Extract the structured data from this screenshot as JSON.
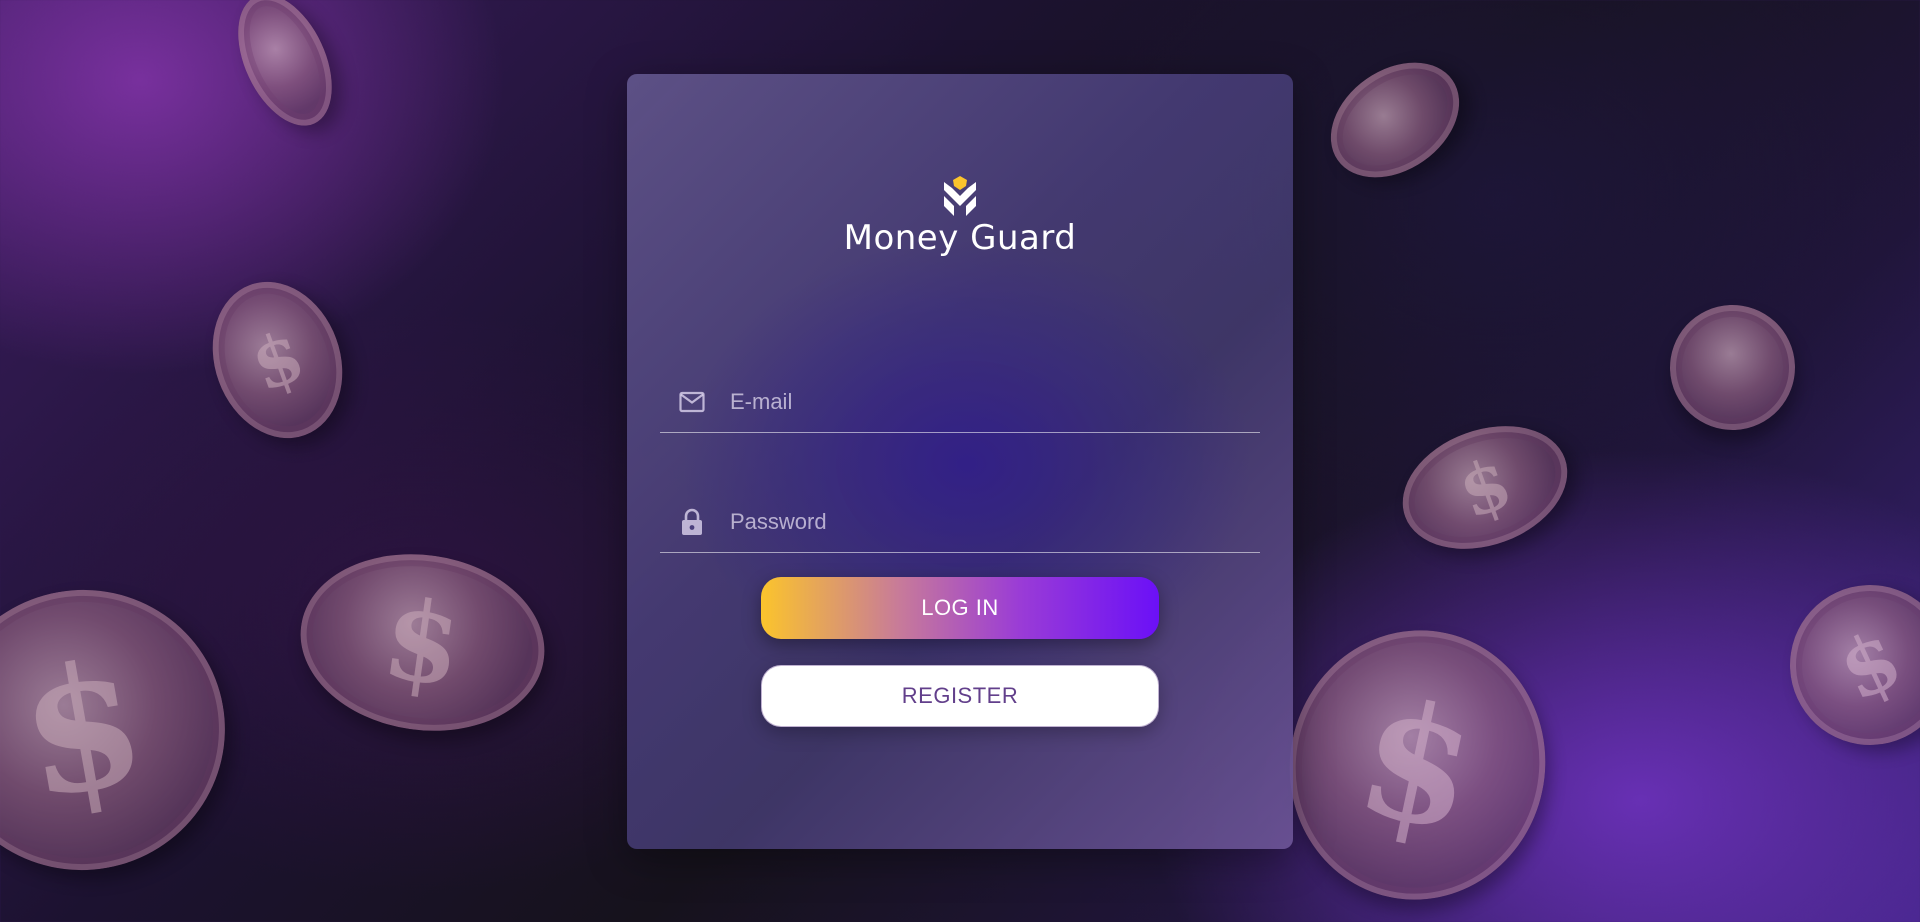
{
  "app": {
    "name": "Money Guard",
    "logo_icon": "money-guard-logo-icon"
  },
  "form": {
    "email": {
      "placeholder": "E-mail",
      "value": "",
      "icon": "envelope-icon"
    },
    "password": {
      "placeholder": "Password",
      "value": "",
      "icon": "lock-icon"
    },
    "login_label": "LOG IN",
    "register_label": "REGISTER"
  },
  "colors": {
    "accent_yellow": "#fbc42c",
    "accent_purple": "#6b10f7",
    "register_text": "#623f8b"
  }
}
